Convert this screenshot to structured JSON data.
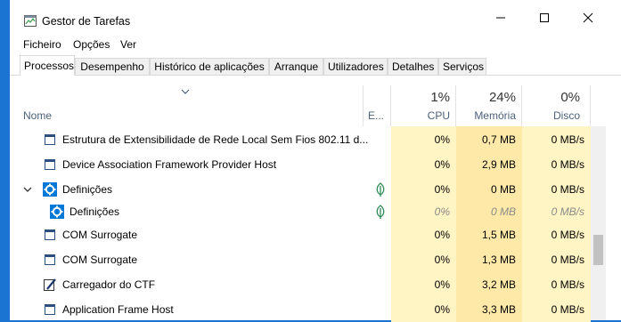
{
  "window": {
    "title": "Gestor de Tarefas",
    "controls": {
      "minimize": "─",
      "maximize": "☐",
      "close": "✕"
    }
  },
  "menu": [
    "Ficheiro",
    "Opções",
    "Ver"
  ],
  "tabs": [
    "Processos",
    "Desempenho",
    "Histórico de aplicações",
    "Arranque",
    "Utilizadores",
    "Detalhes",
    "Serviços"
  ],
  "active_tab": "Processos",
  "columns": {
    "name": "Nome",
    "status": "E...",
    "cpu": {
      "pct": "1%",
      "label": "CPU"
    },
    "memory": {
      "pct": "24%",
      "label": "Memória"
    },
    "disk": {
      "pct": "0%",
      "label": "Disco"
    }
  },
  "rows": [
    {
      "name": "Estrutura de Extensibilidade de Rede Local Sem Fios 802.11 d...",
      "icon": "service-window-icon",
      "cpu": "0%",
      "memory": "0,7 MB",
      "disk": "0 MB/s"
    },
    {
      "name": "Device Association Framework Provider Host",
      "icon": "service-window-icon",
      "cpu": "0%",
      "memory": "2,9 MB",
      "disk": "0 MB/s"
    },
    {
      "name": "Definições",
      "icon": "settings-gear-icon",
      "expanded": true,
      "status_icon": "leaf-icon",
      "cpu": "0%",
      "memory": "0 MB",
      "disk": "0 MB/s"
    },
    {
      "name": "Definições",
      "icon": "settings-gear-icon",
      "child": true,
      "status_icon": "leaf-icon",
      "suspended": true,
      "cpu": "0%",
      "memory": "0 MB",
      "disk": "0 MB/s"
    },
    {
      "name": "COM Surrogate",
      "icon": "service-window-icon",
      "cpu": "0%",
      "memory": "1,5 MB",
      "disk": "0 MB/s"
    },
    {
      "name": "COM Surrogate",
      "icon": "service-window-icon",
      "cpu": "0%",
      "memory": "1,3 MB",
      "disk": "0 MB/s"
    },
    {
      "name": "Carregador do CTF",
      "icon": "pen-icon",
      "cpu": "0%",
      "memory": "3,2 MB",
      "disk": "0 MB/s"
    },
    {
      "name": "Application Frame Host",
      "icon": "service-window-icon",
      "cpu": "0%",
      "memory": "3,3 MB",
      "disk": "0 MB/s"
    }
  ],
  "colors": {
    "accent": "#0078d7",
    "cpu_fill": "#fff4c4",
    "mem_fill": "#ffe9a8",
    "leaf": "#2e8b57"
  }
}
